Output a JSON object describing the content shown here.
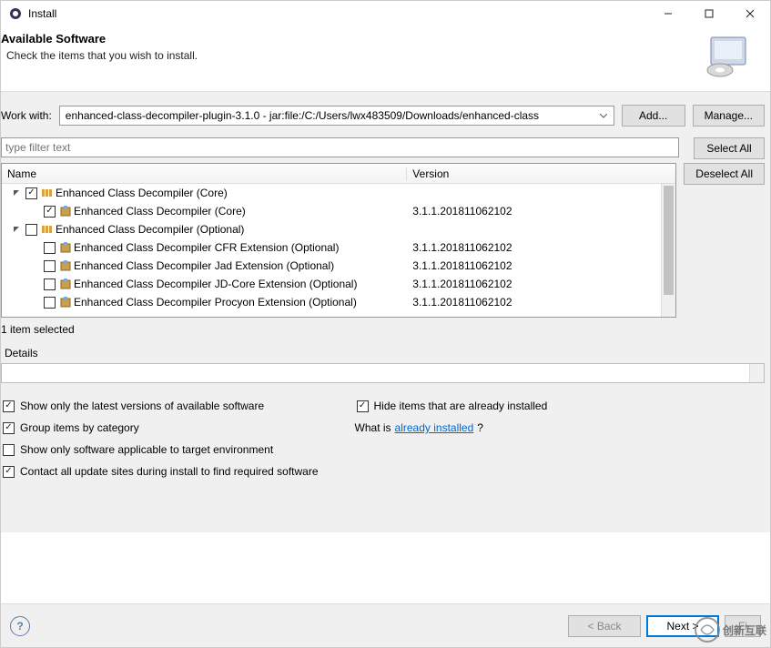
{
  "window": {
    "title": "Install",
    "min_tip": "Minimize",
    "max_tip": "Maximize",
    "close_tip": "Close"
  },
  "header": {
    "title": "Available Software",
    "subtitle": "Check the items that you wish to install."
  },
  "workwith": {
    "label": "Work with:",
    "value": "enhanced-class-decompiler-plugin-3.1.0 - jar:file:/C:/Users/lwx483509/Downloads/enhanced-class",
    "add": "Add...",
    "manage": "Manage..."
  },
  "filter": {
    "placeholder": "type filter text",
    "select_all": "Select All",
    "deselect_all": "Deselect All"
  },
  "columns": {
    "name": "Name",
    "version": "Version"
  },
  "tree": [
    {
      "type": "group",
      "expanded": true,
      "checked": true,
      "label": "Enhanced Class Decompiler (Core)",
      "indent": 0
    },
    {
      "type": "feature",
      "checked": true,
      "label": "Enhanced Class Decompiler (Core)",
      "version": "3.1.1.201811062102",
      "indent": 1
    },
    {
      "type": "group",
      "expanded": true,
      "checked": false,
      "label": "Enhanced Class Decompiler (Optional)",
      "indent": 0
    },
    {
      "type": "feature",
      "checked": false,
      "label": "Enhanced Class Decompiler CFR Extension (Optional)",
      "version": "3.1.1.201811062102",
      "indent": 1
    },
    {
      "type": "feature",
      "checked": false,
      "label": "Enhanced Class Decompiler Jad Extension (Optional)",
      "version": "3.1.1.201811062102",
      "indent": 1
    },
    {
      "type": "feature",
      "checked": false,
      "label": "Enhanced Class Decompiler JD-Core Extension (Optional)",
      "version": "3.1.1.201811062102",
      "indent": 1
    },
    {
      "type": "feature",
      "checked": false,
      "label": "Enhanced Class Decompiler Procyon Extension (Optional)",
      "version": "3.1.1.201811062102",
      "indent": 1
    }
  ],
  "status": "1 item selected",
  "details": {
    "label": "Details"
  },
  "options": {
    "latest_only": {
      "checked": true,
      "label": "Show only the latest versions of available software"
    },
    "group_category": {
      "checked": true,
      "label": "Group items by category"
    },
    "target_env": {
      "checked": false,
      "label": "Show only software applicable to target environment"
    },
    "contact_sites": {
      "checked": true,
      "label": "Contact all update sites during install to find required software"
    },
    "hide_installed": {
      "checked": true,
      "label": "Hide items that are already installed"
    },
    "whatis_prefix": "What is ",
    "whatis_link": "already installed",
    "whatis_suffix": "?"
  },
  "footer": {
    "back": "< Back",
    "next": "Next >",
    "finish": "Finish"
  },
  "watermark": {
    "text": "创新互联"
  }
}
